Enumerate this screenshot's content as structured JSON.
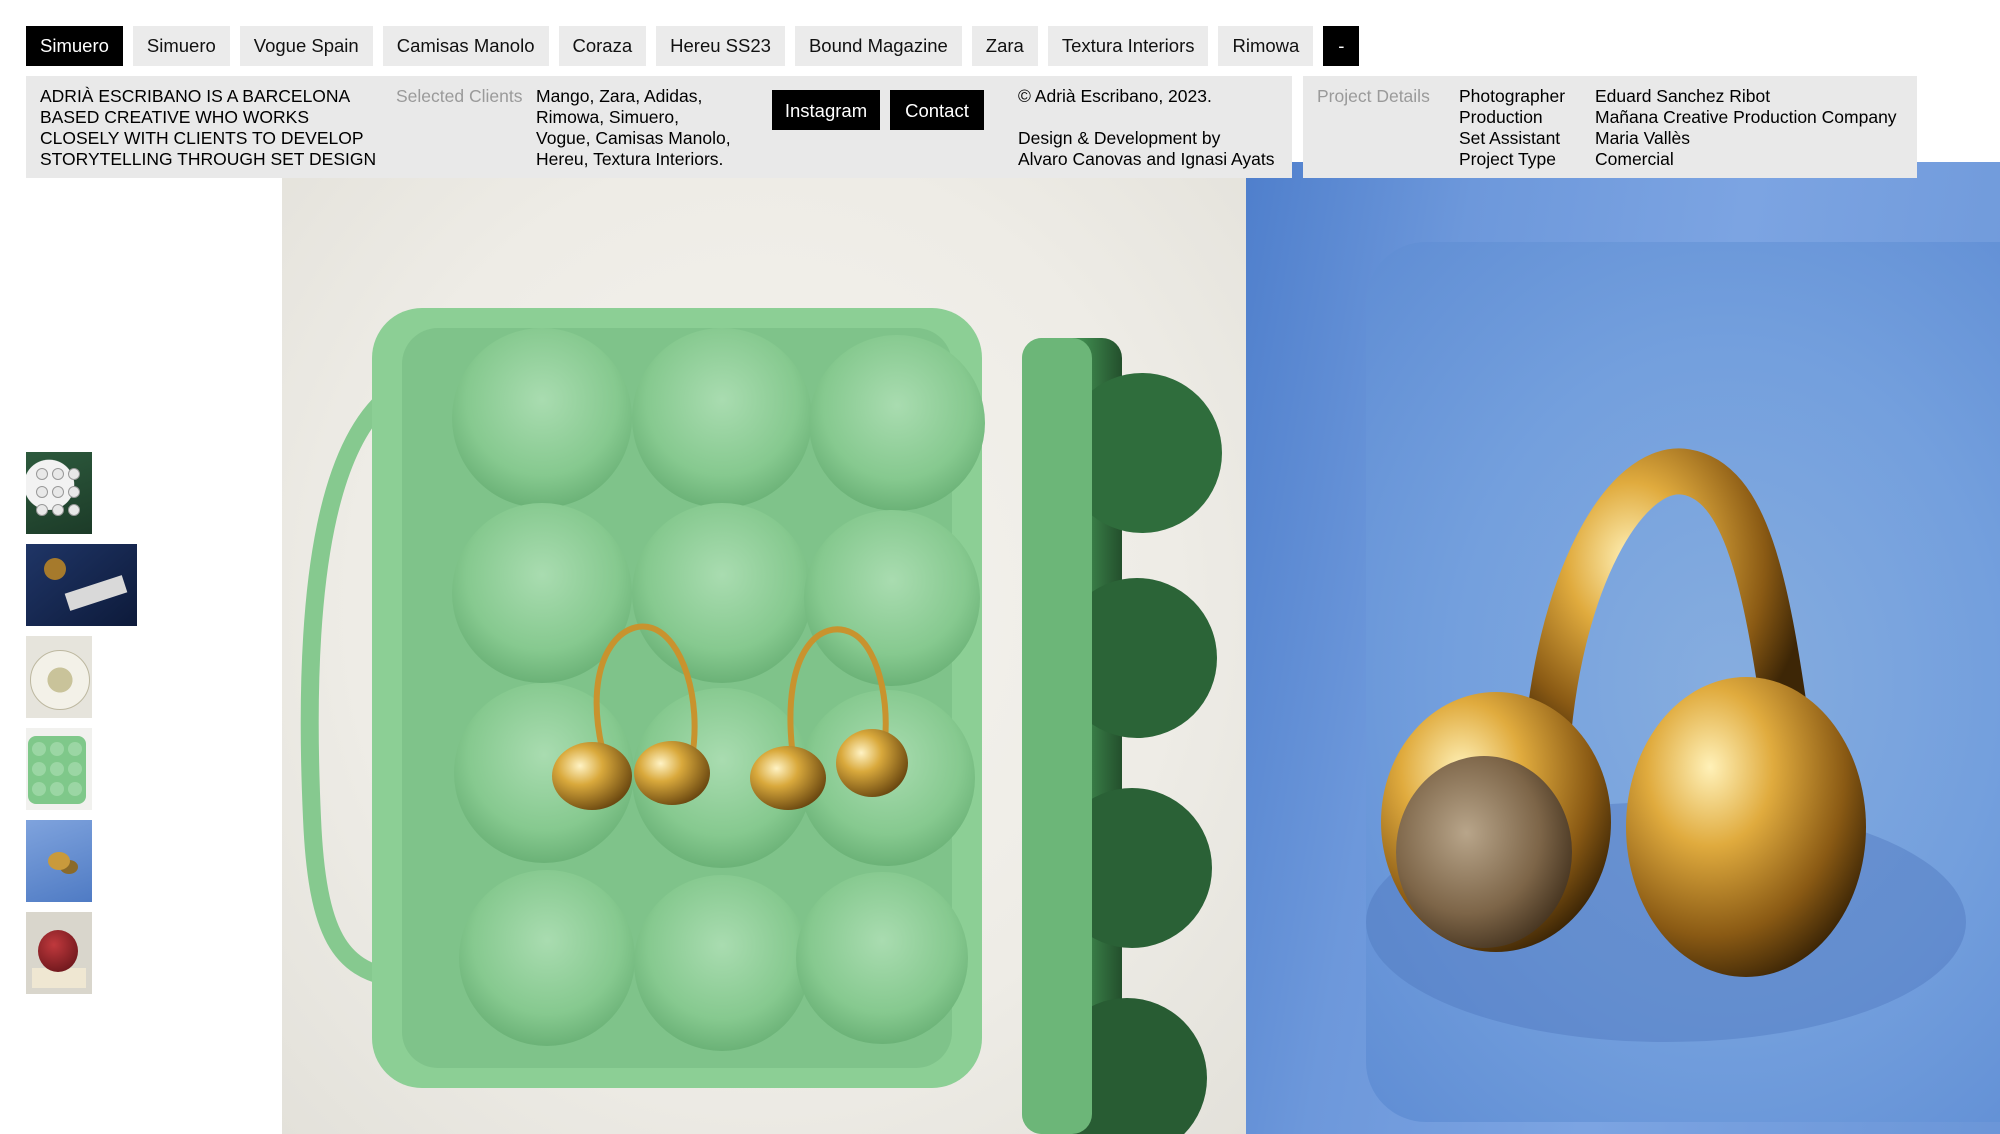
{
  "nav": {
    "items": [
      {
        "label": "Simuero",
        "active": true
      },
      {
        "label": "Simuero",
        "active": false
      },
      {
        "label": "Vogue Spain",
        "active": false
      },
      {
        "label": "Camisas Manolo",
        "active": false
      },
      {
        "label": "Coraza",
        "active": false
      },
      {
        "label": "Hereu SS23",
        "active": false
      },
      {
        "label": "Bound Magazine",
        "active": false
      },
      {
        "label": "Zara",
        "active": false
      },
      {
        "label": "Textura Interiors",
        "active": false
      },
      {
        "label": "Rimowa",
        "active": false
      }
    ],
    "toggle_label": "-"
  },
  "info": {
    "bio_lines": [
      "ADRIÀ ESCRIBANO IS A BARCELONA",
      "BASED CREATIVE WHO WORKS",
      "CLOSELY WITH CLIENTS TO DEVELOP",
      "STORYTELLING THROUGH SET DESIGN"
    ],
    "clients_label": "Selected Clients",
    "clients_lines": [
      "Mango, Zara, Adidas,",
      "Rimowa, Simuero,",
      "Vogue, Camisas Manolo,",
      "Hereu, Textura Interiors."
    ],
    "instagram_label": "Instagram",
    "contact_label": "Contact",
    "copyright": "© Adrià Escribano, 2023.",
    "credits_line1": "Design & Development by",
    "credits_line2": "Alvaro Canovas and Ignasi Ayats"
  },
  "project": {
    "label": "Project Details",
    "rows": [
      {
        "key": "Photographer",
        "value": "Eduard Sanchez Ribot"
      },
      {
        "key": "Production",
        "value": "Mañana Creative Production Company"
      },
      {
        "key": "Set Assistant",
        "value": "Maria Vallès"
      },
      {
        "key": "Project Type",
        "value": "Comercial"
      }
    ]
  },
  "thumbnails": [
    {
      "subject": "egg-tray-dark-green"
    },
    {
      "subject": "comb-and-ring-on-navy"
    },
    {
      "subject": "plate-on-cream"
    },
    {
      "subject": "green-egg-box"
    },
    {
      "subject": "gold-ring-on-blue"
    },
    {
      "subject": "red-apple"
    }
  ],
  "photos": {
    "main_subject": "gold earrings in green egg carton",
    "side_subject": "gold ring with stone on blue surface",
    "colors": {
      "carton_green": "#86c98f",
      "blue_bg": "#6f9ad9",
      "gold": "#c8932e"
    }
  }
}
